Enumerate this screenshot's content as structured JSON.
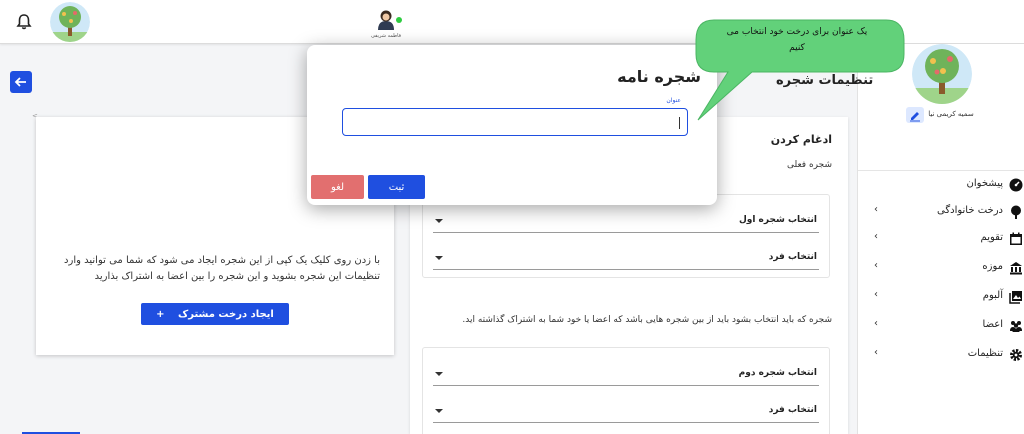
{
  "header": {
    "notifications_icon": "bell-icon",
    "logo_icon": "family-tree-icon",
    "user_name": "فاطمه شریفی",
    "online_color": "#2ecc40"
  },
  "sidebar": {
    "profile_name": "سمیه کریمی نیا",
    "items": [
      {
        "label": "پیشخوان",
        "icon": "dashboard-icon"
      },
      {
        "label": "درخت خانوادگی",
        "icon": "tree-icon"
      },
      {
        "label": "تقویم",
        "icon": "calendar-icon"
      },
      {
        "label": "موزه",
        "icon": "museum-icon"
      },
      {
        "label": "آلبوم",
        "icon": "album-icon"
      },
      {
        "label": "اعضا",
        "icon": "members-icon"
      },
      {
        "label": "تنظیمات",
        "icon": "settings-icon"
      }
    ]
  },
  "page": {
    "title": "تنظیمات شجره",
    "back_icon": "arrow-left-icon"
  },
  "left_card": {
    "description": "با زدن روی کلیک یک کپی از این شجره ایجاد می شود که شما می توانید وارد تنظیمات این شجره بشوید و این شجره را بین اعضا به اشتراک بذارید",
    "create_button": "ایجاد درخت مشترک",
    "create_icon": "+"
  },
  "merge": {
    "title": "ادغام کردن",
    "current_tree_label": "شجره فعلی",
    "first_tree_select": "انتخاب شجره اول",
    "person_select_1": "انتخاب فرد",
    "note": "شجره که باید انتخاب بشود باید از بین شجره هایی باشد که اعضا یا خود شما به اشتراک گذاشته اید.",
    "second_tree_select": "انتخاب شجره دوم",
    "person_select_2": "انتخاب فرد"
  },
  "modal": {
    "title": "شجره نامه",
    "input_label": "عنوان",
    "input_value": "",
    "submit_label": "ثبت",
    "cancel_label": "لغو"
  },
  "tooltip": {
    "text": "یک عنوان برای درخت خود انتخاب می کنیم",
    "color": "#62d17a"
  },
  "colors": {
    "primary": "#1f4fe0",
    "danger": "#e26f6f"
  }
}
